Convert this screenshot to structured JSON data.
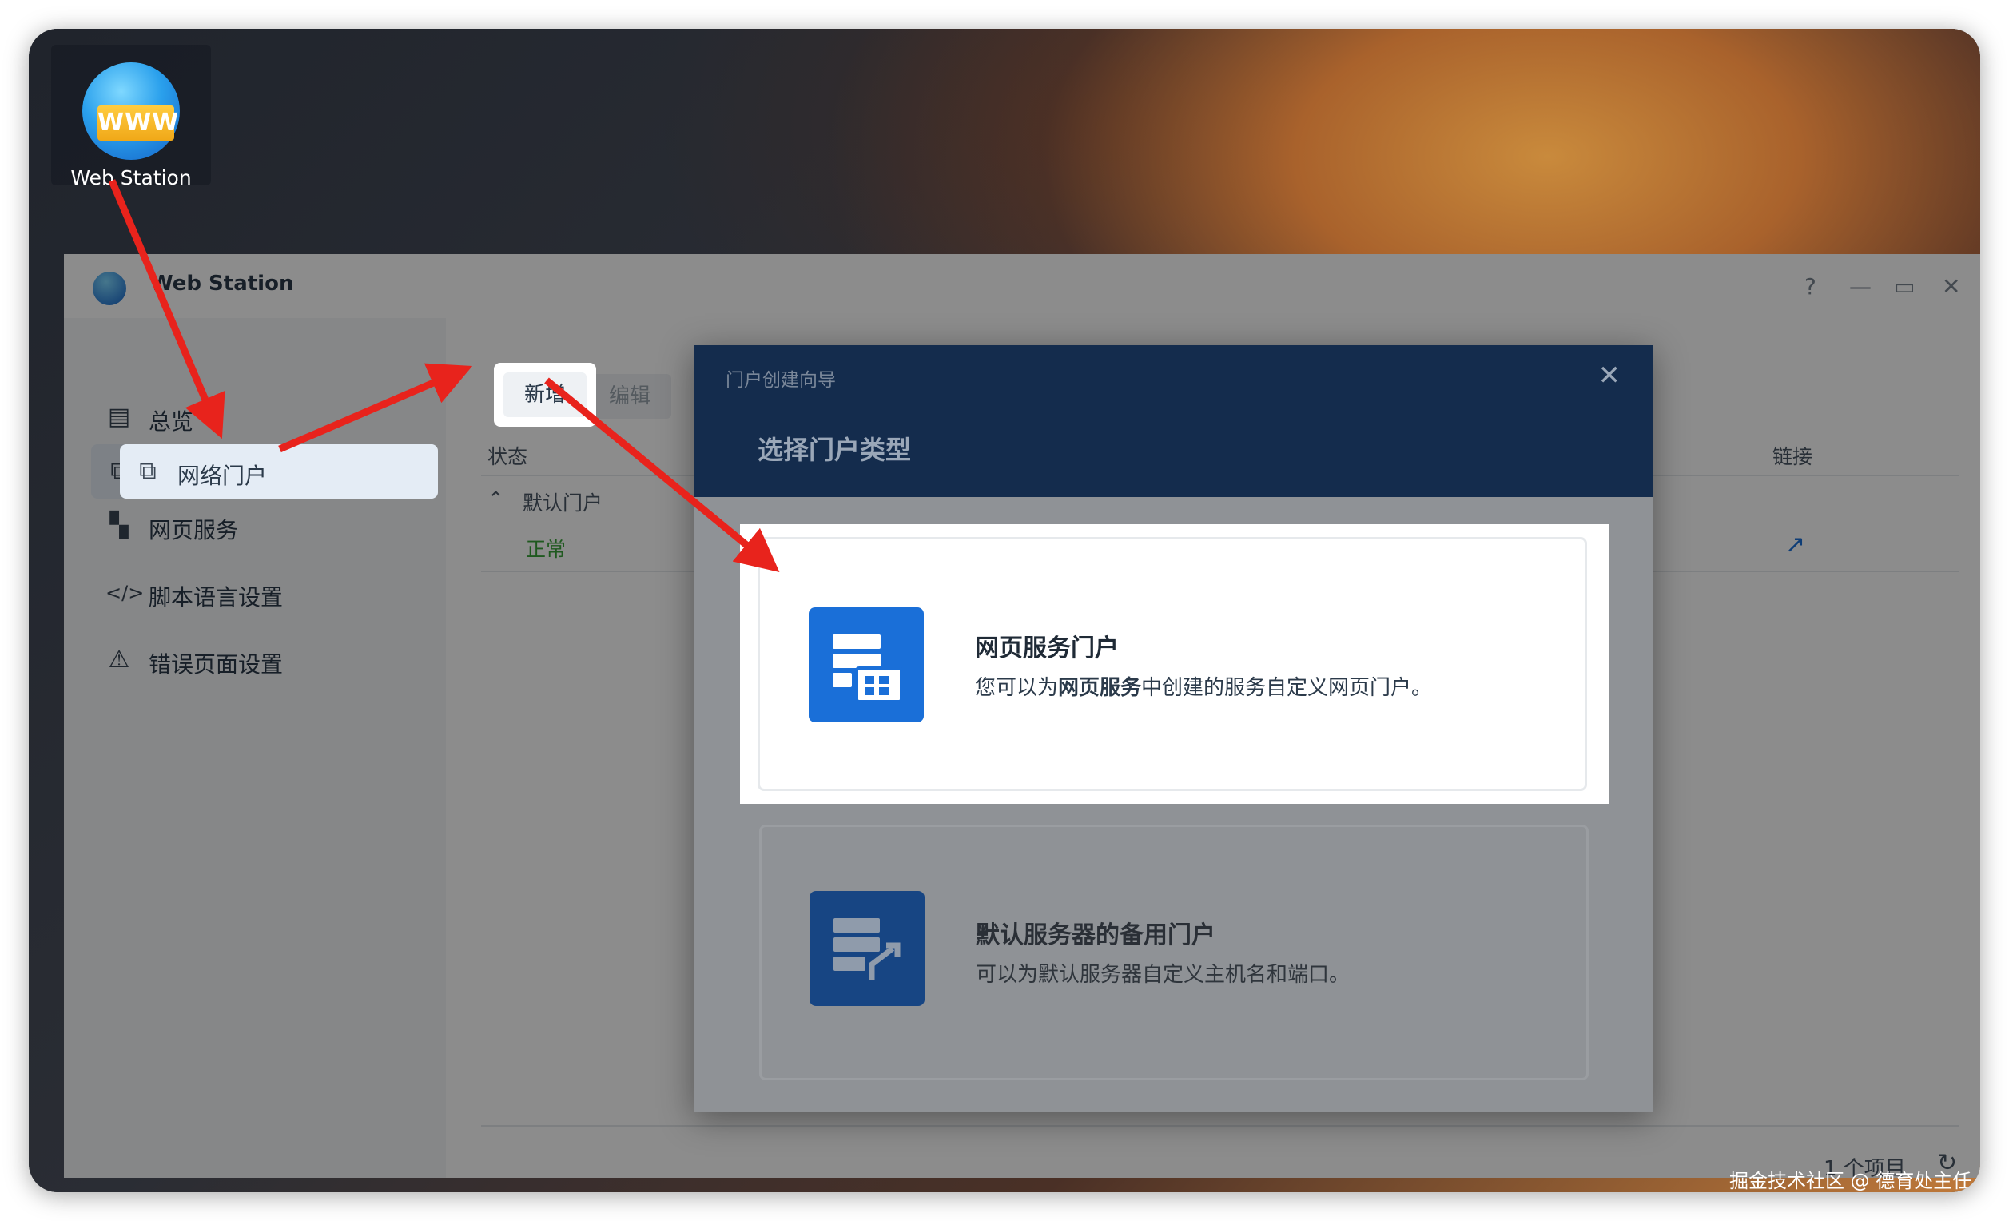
{
  "desktop": {
    "app_icon_text": "WWW",
    "app_label": "Web Station"
  },
  "window": {
    "title": "Web Station",
    "help": "?",
    "minimize": "—",
    "maximize": "▭",
    "close": "✕"
  },
  "sidebar": {
    "items": [
      {
        "label": "总览",
        "icon": "overview-icon"
      },
      {
        "label": "网络门户",
        "icon": "portal-icon"
      },
      {
        "label": "网页服务",
        "icon": "web-service-icon"
      },
      {
        "label": "脚本语言设置",
        "icon": "script-icon"
      },
      {
        "label": "错误页面设置",
        "icon": "error-page-icon"
      }
    ]
  },
  "toolbar": {
    "add_label": "新增",
    "edit_label": "编辑"
  },
  "table": {
    "headers": {
      "status": "状态",
      "link": "链接"
    },
    "group_label": "默认门户",
    "rows": [
      {
        "status": "正常"
      }
    ],
    "count_label": "1 个项目"
  },
  "modal": {
    "wizard_title": "门户创建向导",
    "step_title": "选择门户类型",
    "close": "✕",
    "options": [
      {
        "title": "网页服务门户",
        "desc_pre": "您可以为",
        "desc_bold": "网页服务",
        "desc_post": "中创建的服务自定义网页门户。",
        "icon": "web-service-portal-icon"
      },
      {
        "title": "默认服务器的备用门户",
        "desc": "可以为默认服务器自定义主机名和端口。",
        "icon": "default-server-portal-icon"
      }
    ]
  },
  "watermark": "掘金技术社区 @ 德育处主任",
  "colors": {
    "accent": "#1a6fd8",
    "modal_header": "#142c4d",
    "arrow": "#e8231c",
    "status_ok": "#3aa33a"
  }
}
